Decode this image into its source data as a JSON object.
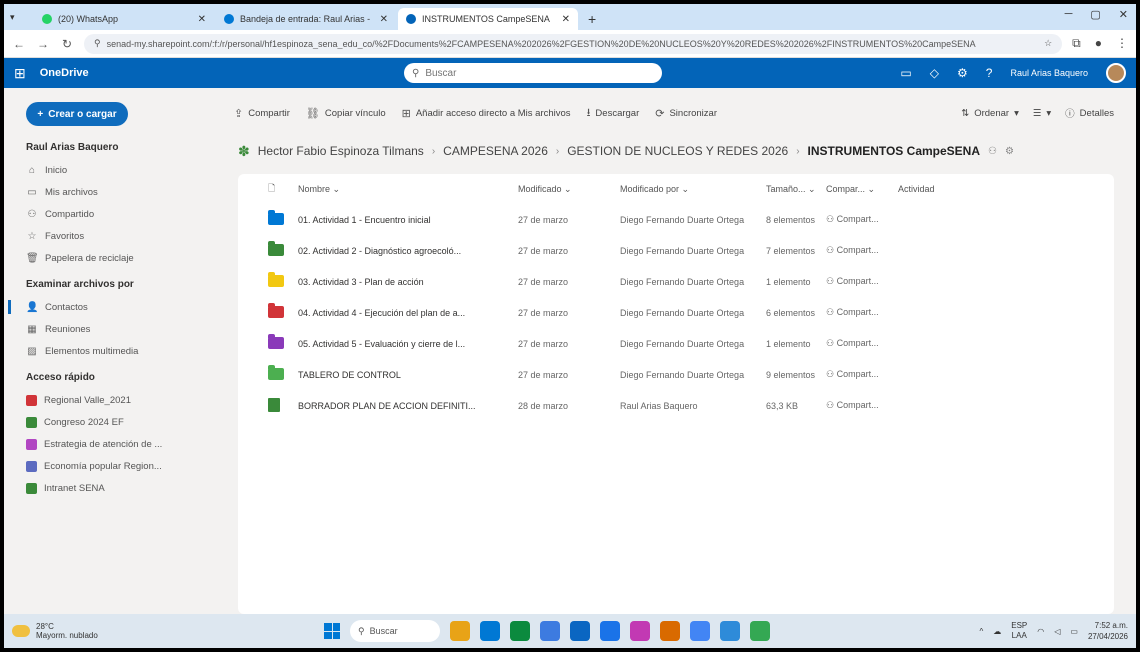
{
  "browser": {
    "tabs": [
      {
        "label": "(20) WhatsApp",
        "color": "#25d366",
        "active": false
      },
      {
        "label": "Bandeja de entrada: Raul Arias - ",
        "color": "#0078d4",
        "active": false
      },
      {
        "label": "INSTRUMENTOS CampeSENA",
        "color": "#0364b8",
        "active": true
      }
    ],
    "url": "senad-my.sharepoint.com/:f:/r/personal/hf1espinoza_sena_edu_co/%2FDocuments%2FCAMPESENA%202026%2FGESTION%20DE%20NUCLEOS%20Y%20REDES%202026%2FINSTRUMENTOS%20CampeSENA"
  },
  "header": {
    "app_name": "OneDrive",
    "search_placeholder": "Buscar",
    "user_name": "Raul Arias Baquero"
  },
  "sidebar": {
    "create_label": "Crear o cargar",
    "user": "Raul Arias Baquero",
    "nav": [
      {
        "label": "Inicio",
        "icon": "⌂"
      },
      {
        "label": "Mis archivos",
        "icon": "▭"
      },
      {
        "label": "Compartido",
        "icon": "⚇"
      },
      {
        "label": "Favoritos",
        "icon": "☆"
      },
      {
        "label": "Papelera de reciclaje",
        "icon": "🗑"
      }
    ],
    "browse_title": "Examinar archivos por",
    "browse": [
      {
        "label": "Contactos",
        "icon": "👤",
        "active": true
      },
      {
        "label": "Reuniones",
        "icon": "▦",
        "active": false
      },
      {
        "label": "Elementos multimedia",
        "icon": "▨",
        "active": false
      }
    ],
    "quick_title": "Acceso rápido",
    "quick": [
      {
        "label": "Regional Valle_2021",
        "color": "#d13438"
      },
      {
        "label": "Congreso 2024 EF",
        "color": "#3a8a3a"
      },
      {
        "label": "Estrategia de atención de ...",
        "color": "#b146c2"
      },
      {
        "label": "Economía popular Region...",
        "color": "#5c6bc0"
      },
      {
        "label": "Intranet SENA",
        "color": "#3a8a3a"
      }
    ]
  },
  "commands": {
    "left": [
      {
        "label": "Compartir",
        "icon": "⇪"
      },
      {
        "label": "Copiar vínculo",
        "icon": "⛓"
      },
      {
        "label": "Añadir acceso directo a Mis archivos",
        "icon": "⊞"
      },
      {
        "label": "Descargar",
        "icon": "⭳"
      },
      {
        "label": "Sincronizar",
        "icon": "⟳"
      }
    ],
    "sort_label": "Ordenar",
    "details_label": "Detalles"
  },
  "breadcrumb": [
    "Hector Fabio Espinoza Tilmans",
    "CAMPESENA 2026",
    "GESTION DE NUCLEOS Y REDES 2026",
    "INSTRUMENTOS CampeSENA"
  ],
  "table": {
    "headers": {
      "name": "Nombre",
      "modified": "Modificado",
      "modified_by": "Modificado por",
      "size": "Tamaño...",
      "sharing": "Compar...",
      "activity": "Actividad"
    },
    "rows": [
      {
        "name": "01. Actividad 1 - Encuentro inicial",
        "modified": "27 de marzo",
        "by": "Diego Fernando Duarte Ortega",
        "size": "8 elementos",
        "sharing": "Compart...",
        "color": "#0078d4",
        "type": "folder"
      },
      {
        "name": "02. Actividad 2 - Diagnóstico agroecoló...",
        "modified": "27 de marzo",
        "by": "Diego Fernando Duarte Ortega",
        "size": "7 elementos",
        "sharing": "Compart...",
        "color": "#3a8a3a",
        "type": "folder"
      },
      {
        "name": "03. Actividad 3 - Plan de acción",
        "modified": "27 de marzo",
        "by": "Diego Fernando Duarte Ortega",
        "size": "1 elemento",
        "sharing": "Compart...",
        "color": "#f2c811",
        "type": "folder"
      },
      {
        "name": "04. Actividad 4 - Ejecución del plan de a...",
        "modified": "27 de marzo",
        "by": "Diego Fernando Duarte Ortega",
        "size": "6 elementos",
        "sharing": "Compart...",
        "color": "#d13438",
        "type": "folder"
      },
      {
        "name": "05. Actividad 5 - Evaluación y cierre de l...",
        "modified": "27 de marzo",
        "by": "Diego Fernando Duarte Ortega",
        "size": "1 elemento",
        "sharing": "Compart...",
        "color": "#8a3ab9",
        "type": "folder"
      },
      {
        "name": "TABLERO DE CONTROL",
        "modified": "27 de marzo",
        "by": "Diego Fernando Duarte Ortega",
        "size": "9 elementos",
        "sharing": "Compart...",
        "color": "#4caf50",
        "type": "folder"
      },
      {
        "name": "BORRADOR PLAN DE ACCION DEFINITI...",
        "modified": "28 de marzo",
        "by": "Raul Arias Baquero",
        "size": "63,3 KB",
        "sharing": "Compart...",
        "color": "#3a8a3a",
        "type": "file"
      }
    ]
  },
  "taskbar": {
    "weather_temp": "28°C",
    "weather_desc": "Mayorm. nublado",
    "search_label": "Buscar",
    "lang": "ESP",
    "lang2": "LAA",
    "time": "7:52 a.m.",
    "date": "27/04/2026",
    "apps": [
      "#e8a317",
      "#0078d4",
      "#0b8a3e",
      "#3d7be0",
      "#0a66c2",
      "#1a73e8",
      "#c239b3",
      "#d96a00",
      "#4285f4",
      "#2e8bd9",
      "#34a853"
    ]
  }
}
